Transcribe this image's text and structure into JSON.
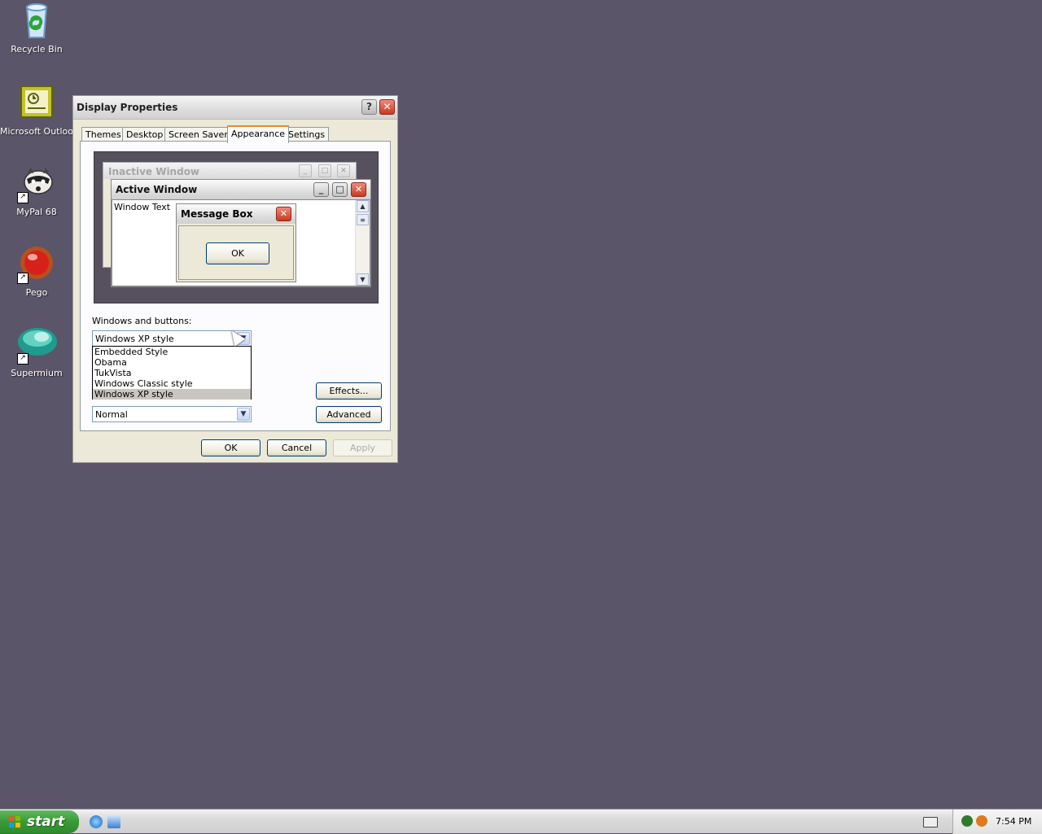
{
  "desktop": {
    "icons": [
      {
        "label": "Recycle Bin",
        "icon": "recycle-bin-icon"
      },
      {
        "label": "Microsoft Outlook",
        "icon": "outlook-icon"
      },
      {
        "label": "MyPal 68",
        "icon": "mypal-icon"
      },
      {
        "label": "Pego",
        "icon": "pego-icon"
      },
      {
        "label": "Supermium",
        "icon": "supermium-icon"
      }
    ]
  },
  "dialog": {
    "title": "Display Properties",
    "tabs": [
      "Themes",
      "Desktop",
      "Screen Saver",
      "Appearance",
      "Settings"
    ],
    "active_tab": "Appearance",
    "preview": {
      "inactive_window_title": "Inactive Window",
      "active_window_title": "Active Window",
      "window_text": "Window Text",
      "message_box_title": "Message Box",
      "message_box_ok": "OK"
    },
    "windows_buttons_label": "Windows and buttons:",
    "windows_buttons_value": "Windows XP style",
    "windows_buttons_options": [
      "Embedded Style",
      "Obama",
      "TukVista",
      "Windows Classic style",
      "Windows XP style"
    ],
    "windows_buttons_selected_index": 4,
    "font_size_value": "Normal",
    "effects_button": "Effects...",
    "advanced_button": "Advanced",
    "ok_button": "OK",
    "cancel_button": "Cancel",
    "apply_button": "Apply"
  },
  "taskbar": {
    "start_label": "start",
    "clock": "7:54 PM"
  },
  "colors": {
    "desktop_bg": "#5a5569",
    "start_green": "#3a9a36",
    "close_red": "#c83a22"
  }
}
